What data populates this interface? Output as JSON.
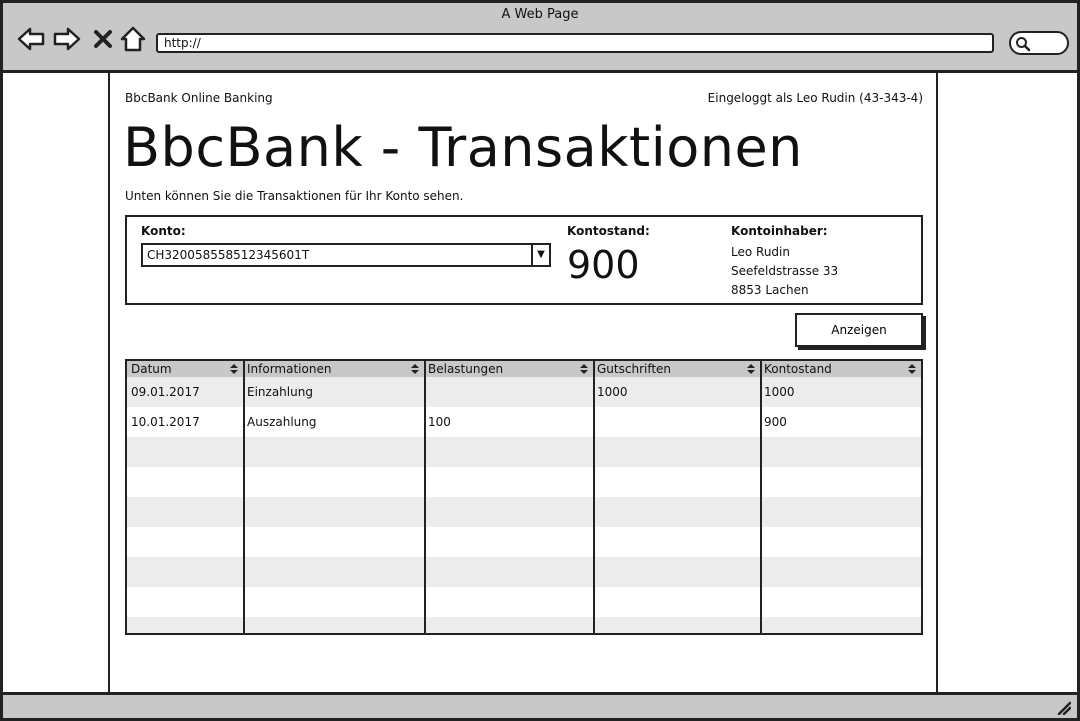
{
  "browser": {
    "window_title": "A Web Page",
    "url": "http://"
  },
  "header": {
    "brand": "BbcBank Online Banking",
    "login_info": "Eingeloggt als Leo Rudin (43-343-4)",
    "title": "BbcBank - Transaktionen",
    "subtitle": "Unten können Sie die Transaktionen für Ihr Konto sehen."
  },
  "account": {
    "konto_label": "Konto:",
    "selected_account": "CH320058558512345601T",
    "balance_label": "Kontostand:",
    "balance_value": "900",
    "holder_label": "Kontoinhaber:",
    "holder_name": "Leo Rudin",
    "holder_street": "Seefeldstrasse 33",
    "holder_city": "8853 Lachen"
  },
  "actions": {
    "show_label": "Anzeigen"
  },
  "table": {
    "columns": [
      "Datum",
      "Informationen",
      "Belastungen",
      "Gutschriften",
      "Kontostand"
    ],
    "rows": [
      [
        "09.01.2017",
        "Einzahlung",
        "",
        "1000",
        "1000"
      ],
      [
        "10.01.2017",
        "Auszahlung",
        "100",
        "",
        "900"
      ],
      [
        "",
        "",
        "",
        "",
        ""
      ],
      [
        "",
        "",
        "",
        "",
        ""
      ],
      [
        "",
        "",
        "",
        "",
        ""
      ],
      [
        "",
        "",
        "",
        "",
        ""
      ],
      [
        "",
        "",
        "",
        "",
        ""
      ],
      [
        "",
        "",
        "",
        "",
        ""
      ],
      [
        "",
        "",
        "",
        "",
        ""
      ]
    ]
  }
}
